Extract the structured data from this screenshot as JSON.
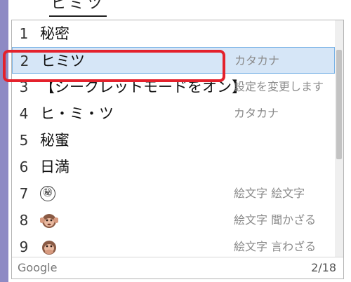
{
  "composition": {
    "text": "ヒミツ"
  },
  "candidates": [
    {
      "num": "1",
      "text": "秘密",
      "annotation": ""
    },
    {
      "num": "2",
      "text": "ヒミツ",
      "annotation": "カタカナ"
    },
    {
      "num": "3",
      "text": "【シークレットモードをオン】",
      "annotation": "設定を変更します"
    },
    {
      "num": "4",
      "text": "ヒ・ミ・ツ",
      "annotation": "カタカナ"
    },
    {
      "num": "5",
      "text": "秘蜜",
      "annotation": ""
    },
    {
      "num": "6",
      "text": "日満",
      "annotation": ""
    },
    {
      "num": "7",
      "text": "㊙",
      "icon": "circled-secret-icon",
      "annotation": "絵文字 絵文字"
    },
    {
      "num": "8",
      "text": "",
      "icon": "hear-no-evil-monkey-icon",
      "annotation": "絵文字 聞かざる"
    },
    {
      "num": "9",
      "text": "",
      "icon": "speak-no-evil-monkey-icon",
      "annotation": "絵文字 言わざる"
    }
  ],
  "selected_index": 2,
  "highlight_index": 3,
  "footer": {
    "provider": "Google",
    "position": "2/18"
  },
  "colors": {
    "selected_bg": "#d6e6f7",
    "highlight_border": "#e4212c",
    "editor_edge": "#8e8ac4"
  }
}
